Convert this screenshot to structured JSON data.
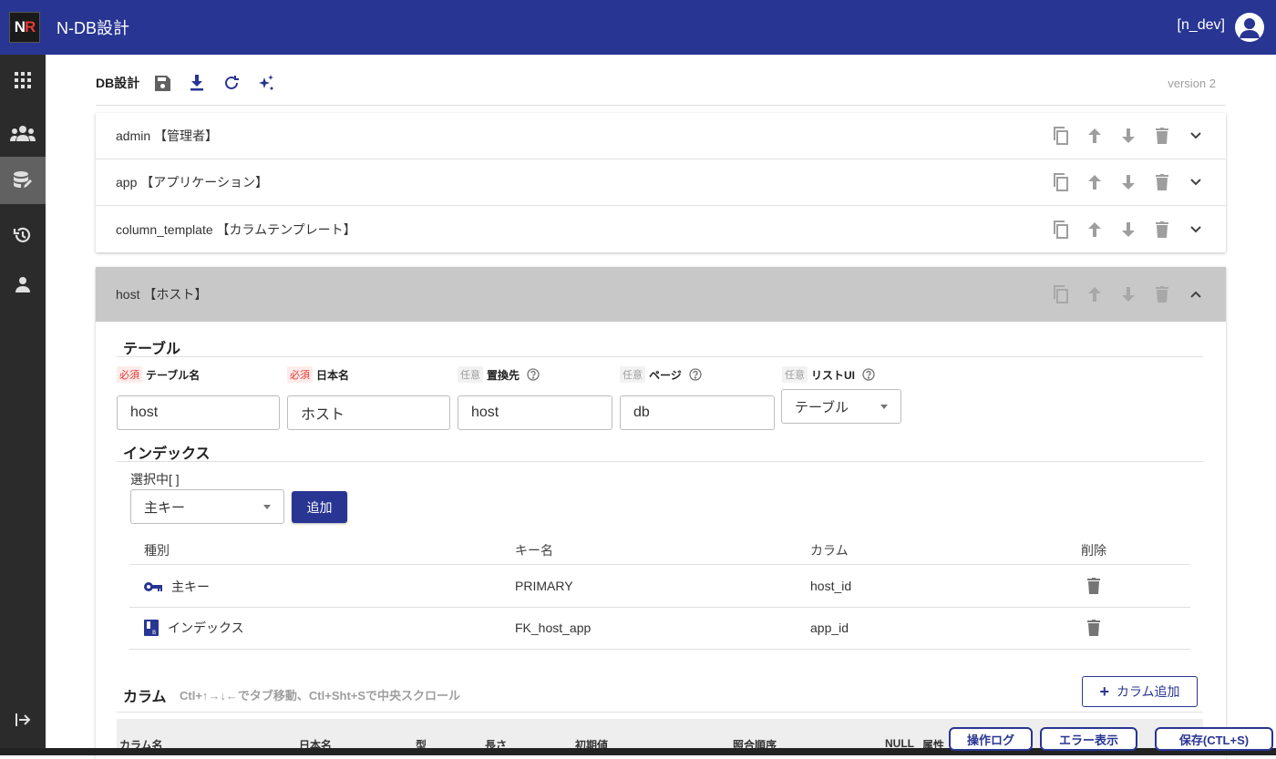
{
  "header": {
    "logo_n": "N",
    "logo_r": "R",
    "app_title": "N-DB設計",
    "user": "[n_dev]"
  },
  "toolbar": {
    "title": "DB設計",
    "version": "version 2"
  },
  "schemas": [
    {
      "label": "admin 【管理者】"
    },
    {
      "label": "app 【アプリケーション】"
    },
    {
      "label": "column_template 【カラムテンプレート】"
    }
  ],
  "host": {
    "label": "host 【ホスト】",
    "table_section": "テーブル",
    "fields": {
      "table_name": {
        "tag": "必須",
        "label": "テーブル名",
        "value": "host"
      },
      "japanese_name": {
        "tag": "必須",
        "label": "日本名",
        "value": "ホスト"
      },
      "replace": {
        "tag": "任意",
        "label": "置換先",
        "value": "host"
      },
      "page": {
        "tag": "任意",
        "label": "ページ",
        "value": "db"
      },
      "list_ui": {
        "tag": "任意",
        "label": "リストUI",
        "value": "テーブル"
      }
    },
    "index_section": "インデックス",
    "selected": "選択中[ ]",
    "index_type_select": "主キー",
    "add_label": "追加",
    "index_headers": {
      "type": "種別",
      "key": "キー名",
      "column": "カラム",
      "delete": "削除"
    },
    "indexes": [
      {
        "type": "主キー",
        "key": "PRIMARY",
        "column": "host_id"
      },
      {
        "type": "インデックス",
        "key": "FK_host_app",
        "column": "app_id"
      }
    ],
    "column_section": "カラム",
    "column_hint": "Ctl+↑→↓←でタブ移動、Ctl+Sht+Sで中央スクロール",
    "column_add": "カラム追加",
    "column_headers": {
      "name": "カラム名",
      "jp": "日本名",
      "type": "型",
      "length": "長さ",
      "default": "初期値",
      "collation": "照合順序",
      "null": "NULL",
      "attr": "属性"
    }
  },
  "footer": {
    "log": "操作ログ",
    "error": "エラー表示",
    "save": "保存(CTL+S)"
  },
  "colors": {
    "primary": "#283593",
    "sidebar": "#2b2b2b",
    "required": "#e53935"
  }
}
